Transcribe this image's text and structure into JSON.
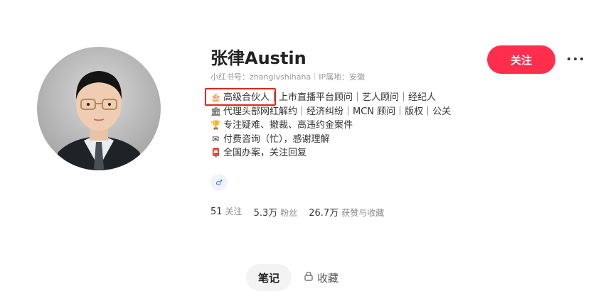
{
  "profile": {
    "name": "张律Austin",
    "id_label": "小红书号：zhanglvshihaha",
    "ip_label": "IP属地：安徽",
    "bio": [
      {
        "icon": "🎂",
        "text": "高级合伙人"
      },
      {
        "icon": "🏛",
        "text": "代理头部网红解约｜经济纠纷｜MCN 顾问｜版权｜公关"
      },
      {
        "icon": "🏆",
        "text": "专注疑难、撤裁、高违约金案件"
      },
      {
        "icon": "✉",
        "text": "付费咨询（忙），感谢理解"
      },
      {
        "icon": "📮",
        "text": "全国办案，关注回复"
      }
    ],
    "bio_line1_rest": "｜上市直播平台顾问｜艺人顾问｜经纪人",
    "badge_icon": "♂",
    "stats": [
      {
        "num": "51",
        "label": "关注"
      },
      {
        "num": "5.3万",
        "label": "粉丝"
      },
      {
        "num": "26.7万",
        "label": "获赞与收藏"
      }
    ]
  },
  "actions": {
    "follow_label": "关注"
  },
  "tabs": {
    "notes": "笔记",
    "collect": "收藏"
  },
  "colors": {
    "accent": "#ff2e4d",
    "highlight": "#e3251c"
  }
}
